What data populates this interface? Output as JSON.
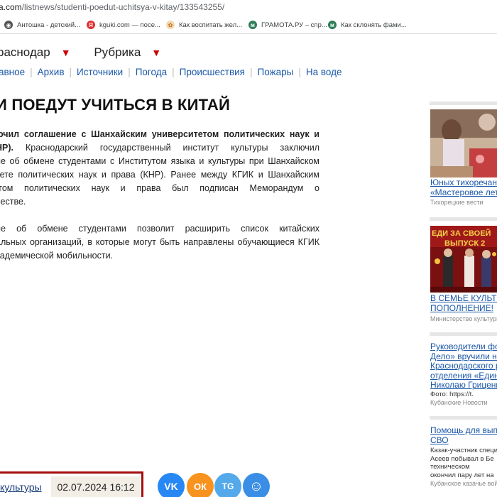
{
  "browser": {
    "url_domain": "a.com",
    "url_path": "/listnews/studenti-poedut-uchitsya-v-kitay/133543255/",
    "bookmarks": [
      {
        "label": "Антошка - детский...",
        "icon": "globe-icon",
        "color": "#555555"
      },
      {
        "label": "kguki.com — посе...",
        "icon": "yandex-icon",
        "color": "#e03030"
      },
      {
        "label": "Как воспитать жел...",
        "icon": "flower-icon",
        "color": "#e0a050"
      },
      {
        "label": "ГРАМОТА.РУ – спр...",
        "icon": "gramota-icon",
        "color": "#2e7d5b"
      },
      {
        "label": "Как склонять фами...",
        "icon": "gramota-icon",
        "color": "#2e7d5b"
      }
    ]
  },
  "header": {
    "region": "раснодар",
    "rubric": "Рубрика",
    "nav": [
      "авное",
      "Архив",
      "Источники",
      "Погода",
      "Происшествия",
      "Пожары",
      "На воде"
    ]
  },
  "article": {
    "headline": "И ПОЕДУТ УЧИТЬСЯ В КИТАЙ",
    "p1": [
      {
        "text": "ючил соглашение с Шанхайским университетом политических наук и",
        "bold": true
      },
      {
        "bold_prefix": "НР).",
        "text": " Краснодарский государственный институт культуры заключил"
      },
      {
        "text": "ие об обмене студентами с Институтом языка и культуры при Шанхайском"
      },
      {
        "text": "тете политических наук и права (КНР). Ранее между КГИК и Шанхайским"
      },
      {
        "text": "ггом политических наук и права был подписан Меморандум о"
      },
      {
        "text": "честве."
      }
    ],
    "p2": [
      {
        "text": "ие об обмене студентами позволит расширить список китайских"
      },
      {
        "text": "альных организаций, в которые могут быть направлены обучающиеся КГИК"
      },
      {
        "text": "кадемической мобильности."
      }
    ]
  },
  "sidebar": {
    "items": [
      {
        "title": [
          "Юных тихоречан н",
          "«Мастеровое лето"
        ],
        "source": "Тихорецкие вести"
      },
      {
        "title": [
          "В СЕМЬЕ КУЛЬТУ",
          "ПОПОЛНЕНИЕ!"
        ],
        "source": "Министерство культуры"
      },
      {
        "title": [
          "Руководители фо",
          "Дело» вручили на",
          "Краснодарского р",
          "отделения «Едино",
          "Николаю Гриценк"
        ],
        "caption": "Фото: https://t.",
        "source": "Кубанские Новости"
      },
      {
        "title": [
          "Помощь для выпу",
          "СВО"
        ],
        "text": [
          "Казак-участник специ",
          "Асеев побывал в Бе",
          "техническом",
          "окончил пару лет на"
        ],
        "source": "Кубанское казачье вой"
      }
    ],
    "image2_banner": "ЕДИ ЗА СВОЕЙ",
    "image2_sub": "ВЫПУСК 2"
  },
  "footer": {
    "link": "культуры",
    "date": "02.07.2024 16:12",
    "social": [
      {
        "name": "vk",
        "label": "VK",
        "color": "#2787f5"
      },
      {
        "name": "odnoklassniki",
        "label": "ОК",
        "color": "#f7931e"
      },
      {
        "name": "telegram",
        "label": "TG",
        "color": "#54a9eb"
      },
      {
        "name": "max",
        "label": "☺",
        "color": "#3b8ee5"
      }
    ]
  }
}
